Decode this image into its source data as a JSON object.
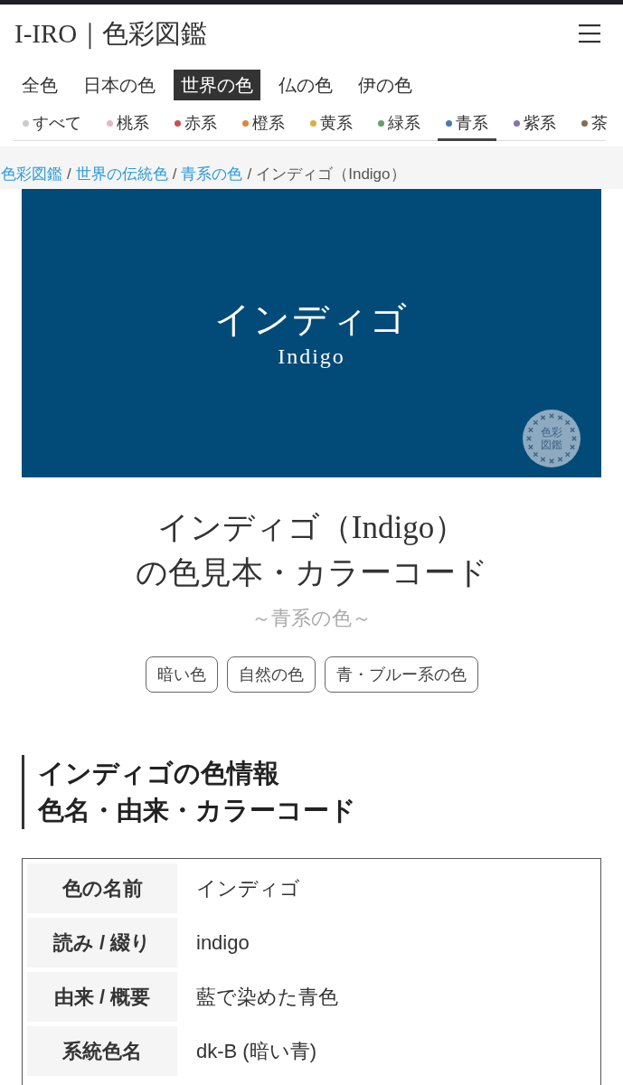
{
  "header": {
    "logo": "I-IRO｜色彩図鑑"
  },
  "nav_tabs": [
    {
      "label": "全色",
      "selected": false
    },
    {
      "label": "日本の色",
      "selected": false
    },
    {
      "label": "世界の色",
      "selected": true
    },
    {
      "label": "仏の色",
      "selected": false
    },
    {
      "label": "伊の色",
      "selected": false
    }
  ],
  "color_filters": [
    {
      "label": "すべて",
      "color": "#cccccc",
      "selected": false
    },
    {
      "label": "桃系",
      "color": "#e8b4c4",
      "selected": false
    },
    {
      "label": "赤系",
      "color": "#c8504e",
      "selected": false
    },
    {
      "label": "橙系",
      "color": "#d8883e",
      "selected": false
    },
    {
      "label": "黄系",
      "color": "#d9b044",
      "selected": false
    },
    {
      "label": "緑系",
      "color": "#62a266",
      "selected": false
    },
    {
      "label": "青系",
      "color": "#4a78b8",
      "selected": true
    },
    {
      "label": "紫系",
      "color": "#8a72b0",
      "selected": false
    },
    {
      "label": "茶",
      "color": "#8a6a52",
      "selected": false
    }
  ],
  "breadcrumb": [
    {
      "kind": "link",
      "text": "色彩図鑑"
    },
    {
      "kind": "separator",
      "text": "/"
    },
    {
      "kind": "link",
      "text": "世界の伝統色"
    },
    {
      "kind": "separator",
      "text": "/"
    },
    {
      "kind": "link",
      "text": "青系の色"
    },
    {
      "kind": "separator",
      "text": "/"
    },
    {
      "kind": "current",
      "text": "インディゴ（Indigo）"
    }
  ],
  "hero": {
    "name": "インディゴ",
    "name_en": "Indigo",
    "seal_lines": [
      "色彩",
      "図鑑"
    ]
  },
  "title_lines": [
    "インディゴ（Indigo）",
    "の色見本・カラーコード"
  ],
  "subtitle": "～青系の色～",
  "tags": [
    "暗い色",
    "自然の色",
    "青・ブルー系の色"
  ],
  "section_heading_lines": [
    "インディゴの色情報",
    "色名・由来・カラーコード"
  ],
  "info_table": {
    "rows": [
      {
        "label": "色の名前",
        "value": "インディゴ"
      },
      {
        "label": "読み / 綴り",
        "value": "indigo"
      },
      {
        "label": "由来 / 概要",
        "value": "藍で染めた青色"
      },
      {
        "label": "系統色名",
        "value": "dk-B (暗い青)"
      }
    ]
  }
}
